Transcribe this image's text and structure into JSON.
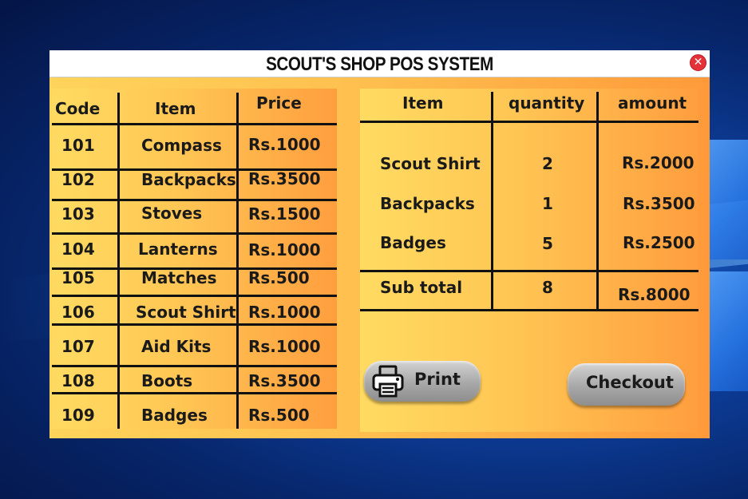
{
  "window": {
    "title": "SCOUT'S SHOP POS SYSTEM"
  },
  "products": {
    "headers": {
      "code": "Code",
      "item": "Item",
      "price": "Price"
    },
    "rows": [
      {
        "code": "101",
        "item": "Compass",
        "price": "Rs.1000"
      },
      {
        "code": "102",
        "item": "Backpacks",
        "price": "Rs.3500"
      },
      {
        "code": "103",
        "item": "Stoves",
        "price": "Rs.1500"
      },
      {
        "code": "104",
        "item": "Lanterns",
        "price": "Rs.1000"
      },
      {
        "code": "105",
        "item": "Matches",
        "price": "Rs.500"
      },
      {
        "code": "106",
        "item": "Scout Shirt",
        "price": "Rs.1000"
      },
      {
        "code": "107",
        "item": "Aid Kits",
        "price": "Rs.1000"
      },
      {
        "code": "108",
        "item": "Boots",
        "price": "Rs.3500"
      },
      {
        "code": "109",
        "item": "Badges",
        "price": "Rs.500"
      }
    ]
  },
  "cart": {
    "headers": {
      "item": "Item",
      "quantity": "quantity",
      "amount": "amount"
    },
    "rows": [
      {
        "item": "Scout Shirt",
        "quantity": "2",
        "amount": "Rs.2000"
      },
      {
        "item": "Backpacks",
        "quantity": "1",
        "amount": "Rs.3500"
      },
      {
        "item": "Badges",
        "quantity": "5",
        "amount": "Rs.2500"
      }
    ],
    "subtotal": {
      "label": "Sub total",
      "quantity": "8",
      "amount": "Rs.8000"
    }
  },
  "buttons": {
    "print": "Print",
    "checkout": "Checkout"
  },
  "icons": {
    "close": "close-icon",
    "print": "printer-icon"
  },
  "colors": {
    "panel_start": "#ffd45a",
    "panel_end": "#ff9a3a",
    "close": "#e53238",
    "desktop": "#0d3f9c"
  }
}
